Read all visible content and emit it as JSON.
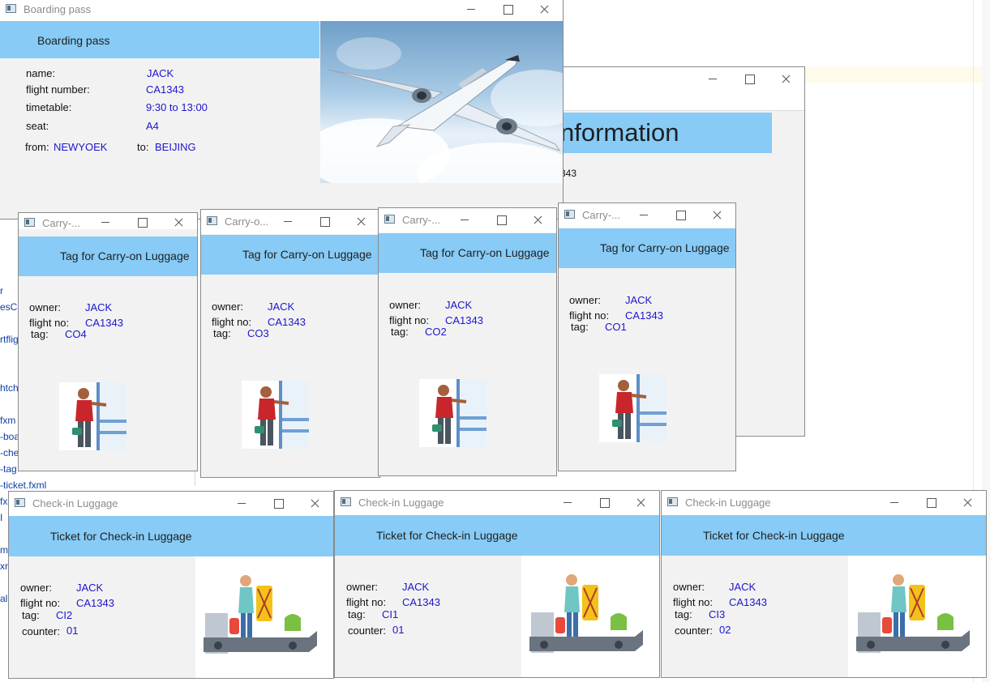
{
  "boarding_pass": {
    "window_title": "Boarding pass",
    "heading": "Boarding pass",
    "fields": [
      {
        "label": "name:",
        "value": "JACK"
      },
      {
        "label": "flight number:",
        "value": "CA1343"
      },
      {
        "label": "timetable:",
        "value": "9:30 to 13:00"
      },
      {
        "label": "seat:",
        "value": "A4"
      }
    ],
    "from_label": "from:",
    "from_value": "NEWYOEK",
    "to_label": "to:",
    "to_value": "BEIJING",
    "image": "airplane-in-sky"
  },
  "info_window": {
    "heading_fragment": "nformation",
    "value_fragment": "343"
  },
  "carry_on_tags": [
    {
      "window_title": "Carry-...",
      "heading": "Tag for Carry-on Luggage",
      "owner_label": "owner:",
      "owner": "JACK",
      "flight_label": "flight no:",
      "flight": "CA1343",
      "tag_label": "tag:",
      "tag": "CO4"
    },
    {
      "window_title": "Carry-o...",
      "heading": "Tag for Carry-on Luggage",
      "owner_label": "owner:",
      "owner": "JACK",
      "flight_label": "flight no:",
      "flight": "CA1343",
      "tag_label": "tag:",
      "tag": "CO3"
    },
    {
      "window_title": "Carry-...",
      "heading": "Tag for Carry-on Luggage",
      "owner_label": "owner:",
      "owner": "JACK",
      "flight_label": "flight no:",
      "flight": "CA1343",
      "tag_label": "tag:",
      "tag": "CO2"
    },
    {
      "window_title": "Carry-...",
      "heading": "Tag for Carry-on Luggage",
      "owner_label": "owner:",
      "owner": "JACK",
      "flight_label": "flight no:",
      "flight": "CA1343",
      "tag_label": "tag:",
      "tag": "CO1"
    }
  ],
  "check_in_tickets": [
    {
      "window_title": "Check-in Luggage",
      "heading": "Ticket for Check-in Luggage",
      "owner_label": "owner:",
      "owner": "JACK",
      "flight_label": "flight no:",
      "flight": "CA1343",
      "tag_label": "tag:",
      "tag": "CI2",
      "counter_label": "counter:",
      "counter": "01"
    },
    {
      "window_title": "Check-in Luggage",
      "heading": "Ticket for Check-in Luggage",
      "owner_label": "owner:",
      "owner": "JACK",
      "flight_label": "flight no:",
      "flight": "CA1343",
      "tag_label": "tag:",
      "tag": "CI1",
      "counter_label": "counter:",
      "counter": "01"
    },
    {
      "window_title": "Check-in Luggage",
      "heading": "Ticket for Check-in Luggage",
      "owner_label": "owner:",
      "owner": "JACK",
      "flight_label": "flight no:",
      "flight": "CA1343",
      "tag_label": "tag:",
      "tag": "CI3",
      "counter_label": "counter:",
      "counter": "02"
    }
  ],
  "ide_fragments": [
    "r",
    "esCo",
    "rtflig",
    "htch",
    "fxm",
    "-boa",
    "-che",
    "-tag",
    "-ticket.fxml",
    "fx",
    "I",
    "ml",
    "xr",
    "al"
  ]
}
